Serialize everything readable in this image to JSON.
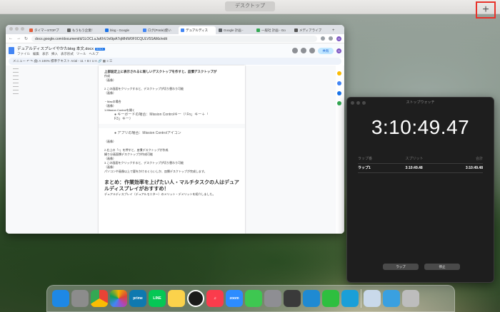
{
  "menubar": {
    "label": "デスクトップ",
    "add_space": "+"
  },
  "chrome": {
    "tabs": [
      {
        "label": "タイマーSTOPプ",
        "color": "#e25c3a"
      },
      {
        "label": "もうもう企業！",
        "color": "#666666"
      },
      {
        "label": "blog - Google",
        "color": "#1a73e8"
      },
      {
        "label": "ログ(Pratie)使い",
        "color": "#4285f4"
      },
      {
        "label": "デュアルディス",
        "color": "#4285f4"
      },
      {
        "label": "Google 計画 -",
        "color": "#5f6368"
      },
      {
        "label": "一般社 計画 - Go",
        "color": "#34a853"
      },
      {
        "label": "メディアライブ",
        "color": "#555555"
      }
    ],
    "url": "docs.google.com/document/d/1LOCLuJaKhVJx6tpA7qMhIW0F0CQULV5SAMz/edit",
    "doc_title": "デュアルディスプレイやかたblog 本文.docx",
    "doc_badge": "DOCX",
    "doc_menu": [
      "ファイル",
      "編集",
      "表示",
      "挿入",
      "表示形式",
      "ツール",
      "ヘルプ"
    ],
    "share_label": "共有",
    "avatar": "H",
    "format_bar": "メニュー   ↶  ↷  🖨  A  100%   標準テキスト   Arial   -  11  +   B  I  U  A   🔗  ▦  ≡  ☰",
    "page_lines": [
      {
        "text": "上部設定上に表示されるに新しいデスクトップを作すと、皿慣デスクトップが",
        "style": "b"
      },
      {
        "text": "作成",
        "style": ""
      },
      {
        "text": "（画像）",
        "style": ""
      },
      {
        "text": "",
        "style": ""
      },
      {
        "text": "2.この画面をクリックすると、デスクトップが切り替わり可能",
        "style": ""
      },
      {
        "text": "（画像）",
        "style": ""
      },
      {
        "text": "",
        "style": ""
      },
      {
        "text": "・Macの場合",
        "style": ""
      },
      {
        "text": "（画像）",
        "style": ""
      },
      {
        "text": "1.Mission Controlを開く",
        "style": ""
      },
      {
        "text": "  ● キーボードの場合：Mission Controlキー（「Fn」キー＋「",
        "style": "mid"
      },
      {
        "text": "     F3」キー）",
        "style": "mid"
      }
    ],
    "page2_lines": [
      {
        "text": "● アプリの場合：Mission Controlアイコン",
        "style": "mid"
      },
      {
        "text": "",
        "style": ""
      },
      {
        "text": "（画像）",
        "style": ""
      },
      {
        "text": "",
        "style": ""
      },
      {
        "text": "2.右上の「+」を押すと、皿慣デスクトップが作成",
        "style": ""
      },
      {
        "text": "繰り分画面慣デスクトップが作成可能",
        "style": ""
      },
      {
        "text": "（画像）",
        "style": ""
      },
      {
        "text": "3.この画面をクリックすると、デスクトップが切り替わり可能",
        "style": ""
      },
      {
        "text": "（画像）",
        "style": ""
      },
      {
        "text": "パソコンや画像以上で要をかけるくらいしか、皿慣デスクトップが完成します。",
        "style": ""
      }
    ],
    "heading": "まとめ：作業効率を上げたい人・マルチタスクの人はデュアルディスプレイがおすすめ！",
    "heading_sub": "デュアルディスプレイ（デュアルモニター）のメリット・デメリットを紹介しました。"
  },
  "stopwatch": {
    "title": "ストップウォッチ",
    "time": "3:10:49.47",
    "columns": [
      "ラップ番",
      "スプリット",
      "合計"
    ],
    "laps": [
      {
        "name": "ラップ1",
        "split": "3:10:49.48",
        "total": "3:10:49.48"
      }
    ],
    "lap_button": "ラップ",
    "stop_button": "停止"
  },
  "dock": {
    "apps": [
      {
        "name": "finder",
        "label": "",
        "color": "#1e88e5"
      },
      {
        "name": "launchpad",
        "label": "",
        "color": "#8c8c8c"
      },
      {
        "name": "chrome",
        "label": "",
        "color": "#ffffff"
      },
      {
        "name": "photos",
        "label": "",
        "color": "#ffffff"
      },
      {
        "name": "prime-video",
        "label": "prime",
        "color": "#0f79af"
      },
      {
        "name": "line",
        "label": "LINE",
        "color": "#06c755"
      },
      {
        "name": "notes",
        "label": "",
        "color": "#fbd24b"
      },
      {
        "name": "clock",
        "label": "",
        "color": "#1a1a1a"
      },
      {
        "name": "music",
        "label": "♫",
        "color": "#fa3c4c"
      },
      {
        "name": "zoom",
        "label": "zoom",
        "color": "#2d8cff"
      },
      {
        "name": "facetime",
        "label": "",
        "color": "#3ec751"
      },
      {
        "name": "system-settings",
        "label": "",
        "color": "#8e8e93"
      },
      {
        "name": "calculator",
        "label": "",
        "color": "#3a3a3a"
      },
      {
        "name": "vscode",
        "label": "",
        "color": "#1f8ad2"
      },
      {
        "name": "numbers",
        "label": "",
        "color": "#2ebf3f"
      },
      {
        "name": "edge",
        "label": "",
        "color": "#1a9fd8"
      },
      {
        "name": "preview",
        "label": "",
        "color": "#c9d9ea"
      },
      {
        "name": "downloads",
        "label": "",
        "color": "#3aa0e0"
      },
      {
        "name": "trash",
        "label": "",
        "color": "#bdbdbd"
      }
    ]
  }
}
